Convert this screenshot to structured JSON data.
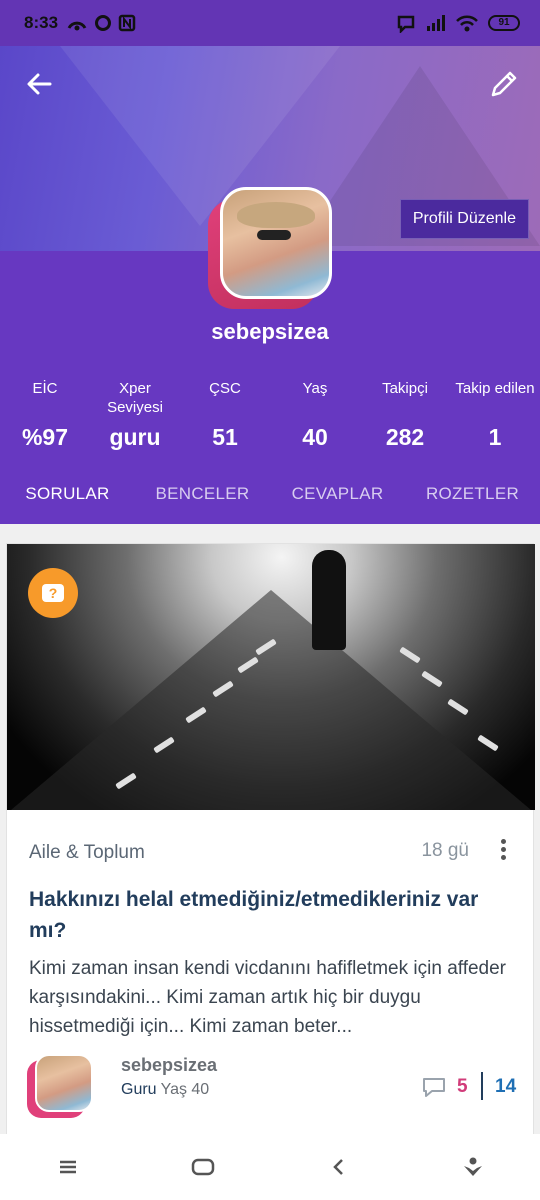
{
  "status_bar": {
    "time": "8:33",
    "battery": "91"
  },
  "profile": {
    "edit_profile_label": "Profili Düzenle",
    "username": "sebepsizea"
  },
  "stats": [
    {
      "label": "EİC",
      "value": "%97"
    },
    {
      "label": "Xper Seviyesi",
      "value": "guru"
    },
    {
      "label": "ÇSC",
      "value": "51"
    },
    {
      "label": "Yaş",
      "value": "40"
    },
    {
      "label": "Takipçi",
      "value": "282"
    },
    {
      "label": "Takip edilen",
      "value": "1"
    }
  ],
  "tabs": [
    {
      "label": "SORULAR",
      "active": true
    },
    {
      "label": "BENCELER",
      "active": false
    },
    {
      "label": "CEVAPLAR",
      "active": false
    },
    {
      "label": "ROZETLER",
      "active": false
    }
  ],
  "post": {
    "category": "Aile & Toplum",
    "time_ago": "18 gü",
    "title": "Hakkınızı helal etmediğiniz/etmedikleriniz var mı?",
    "excerpt": "Kimi zaman insan kendi vicdanını hafifletmek için affeder karşısındakini... Kimi zaman artık hiç bir duygu hissetmediği için... Kimi zaman beter...",
    "author_name": "sebepsizea",
    "author_level": "Guru",
    "author_age": "Yaş 40",
    "comment_count": "5",
    "like_count": "14"
  },
  "colors": {
    "header_purple": "#6738c1",
    "accent_pink": "#d13c7a",
    "accent_blue": "#1f6fb4",
    "badge_orange": "#f79a2a"
  }
}
